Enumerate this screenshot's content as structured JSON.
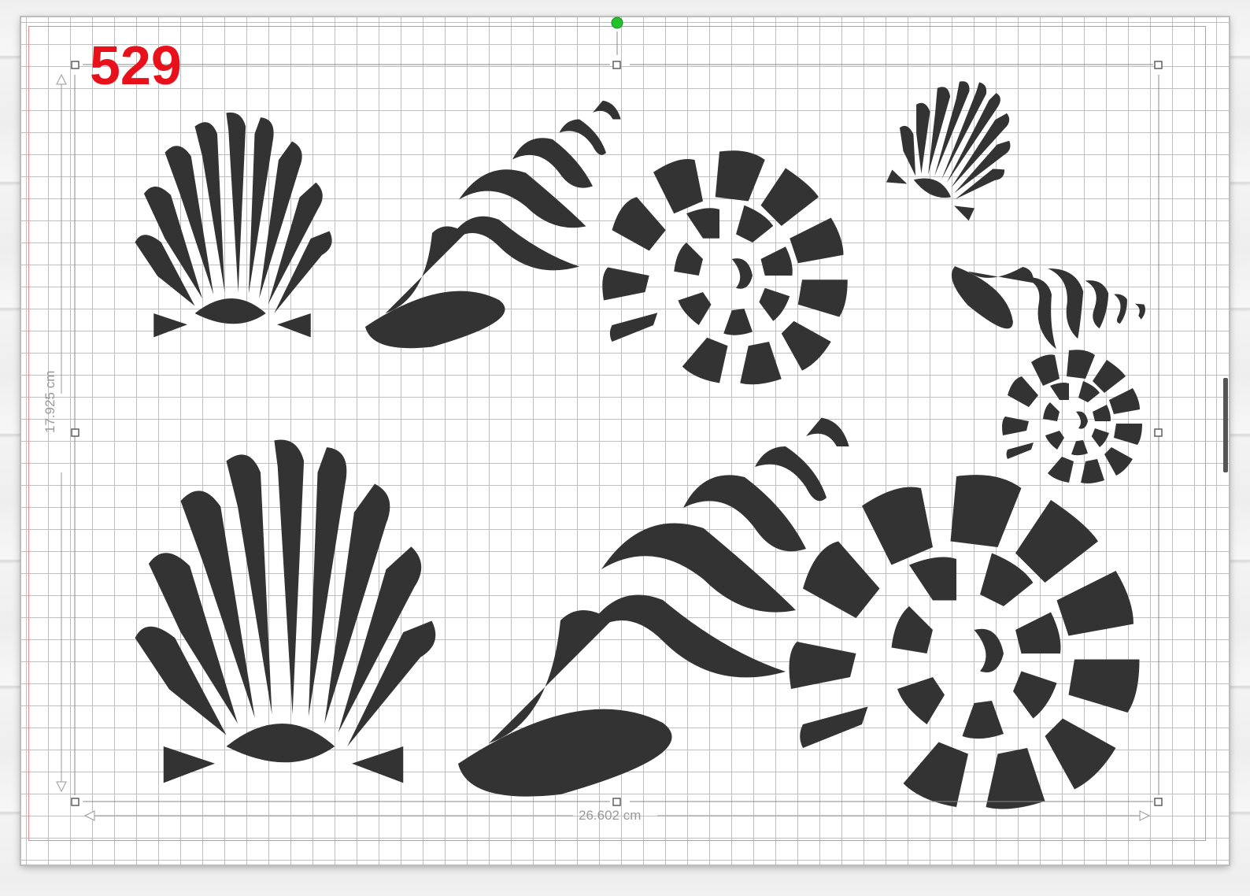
{
  "design": {
    "number_label": "529",
    "width_label": "26.602 cm",
    "height_label": "17.925 cm"
  },
  "shapes": [
    {
      "name": "scallop-shell",
      "size": "large"
    },
    {
      "name": "conch-shell",
      "size": "large"
    },
    {
      "name": "nautilus-shell",
      "size": "large"
    },
    {
      "name": "scallop-shell",
      "size": "medium"
    },
    {
      "name": "conch-shell",
      "size": "medium"
    },
    {
      "name": "nautilus-shell",
      "size": "medium"
    },
    {
      "name": "scallop-shell",
      "size": "small"
    },
    {
      "name": "conch-shell",
      "size": "small"
    },
    {
      "name": "nautilus-shell",
      "size": "small"
    }
  ],
  "colors": {
    "shape_fill": "#333333",
    "number_label": "#e8111b",
    "rotate_handle": "#22c22a",
    "grid": "#bfbfbf"
  }
}
